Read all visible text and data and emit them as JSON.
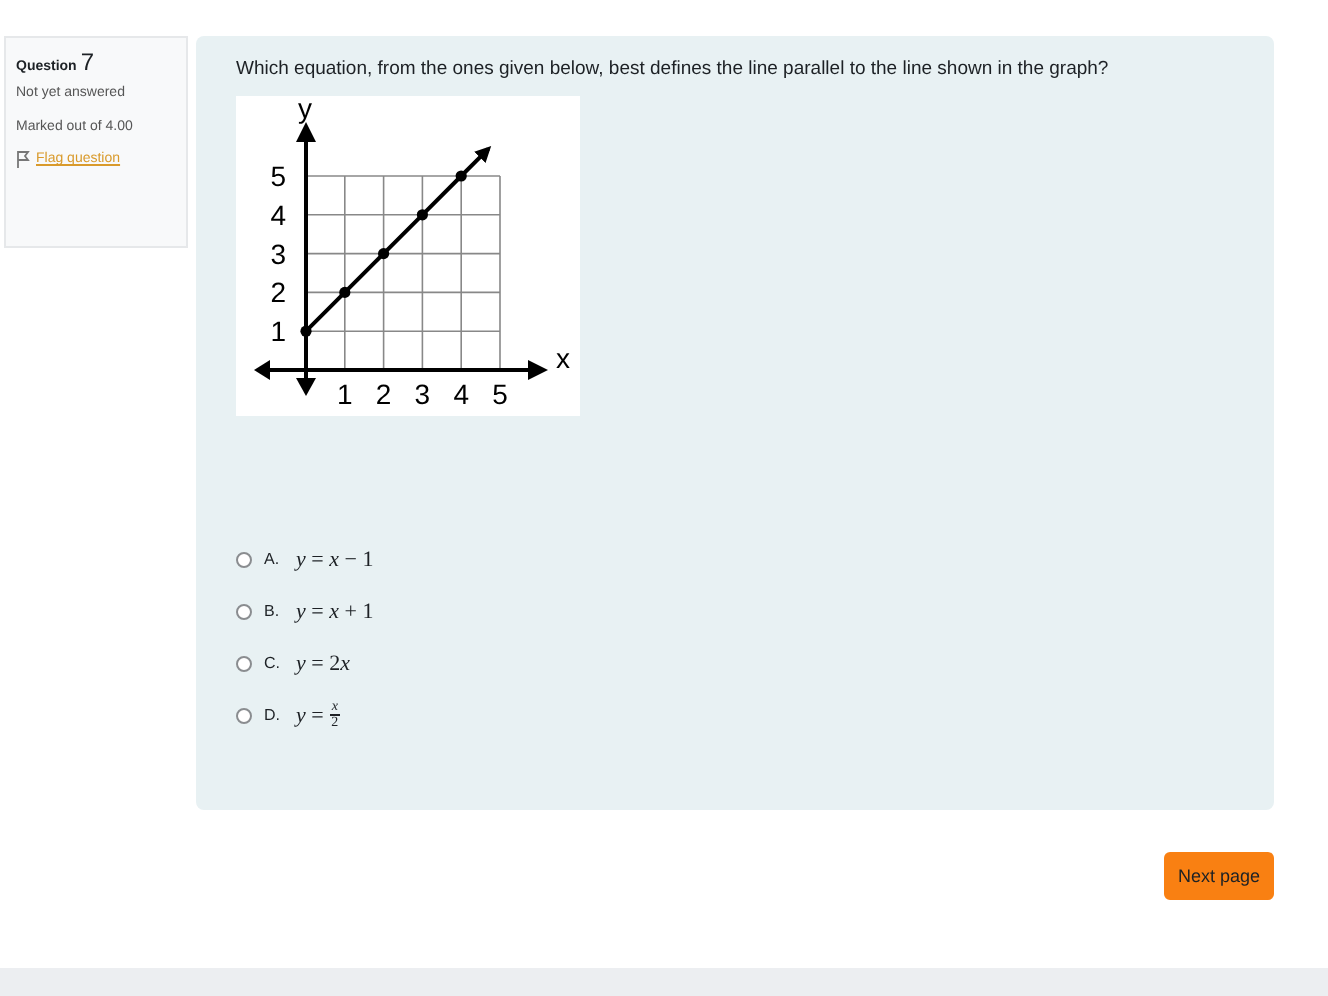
{
  "question_info": {
    "label": "Question",
    "number": "7",
    "status": "Not yet answered",
    "marks": "Marked out of 4.00",
    "flag_link": "Flag question"
  },
  "question": {
    "text": "Which equation, from the ones given below, best defines the line parallel to the line shown in the graph?",
    "chart_data": {
      "type": "line",
      "xlabel": "x",
      "ylabel": "y",
      "x": [
        0,
        1,
        2,
        3,
        4
      ],
      "grid": true,
      "series": [
        {
          "color": "#000000",
          "marker": "circle",
          "values": [
            1,
            2,
            3,
            4,
            5
          ]
        }
      ],
      "xlim": [
        0,
        5
      ],
      "ylim": [
        0,
        5
      ],
      "xticks": [
        1,
        2,
        3,
        4,
        5
      ],
      "yticks": [
        1,
        2,
        3,
        4,
        5
      ]
    }
  },
  "options": [
    {
      "letter": "A.",
      "kind": "inline",
      "math": "*y* = *x* − 1",
      "selected": false
    },
    {
      "letter": "B.",
      "kind": "inline",
      "math": "*y* = *x* + 1",
      "selected": false
    },
    {
      "letter": "C.",
      "kind": "coefficient",
      "math": "*y* = 2",
      "variable": "x",
      "selected": false
    },
    {
      "letter": "D.",
      "kind": "fraction",
      "math": "*y* =",
      "numerator": "*x*",
      "denominator": "2",
      "selected": false
    }
  ],
  "next_button": "Next page"
}
